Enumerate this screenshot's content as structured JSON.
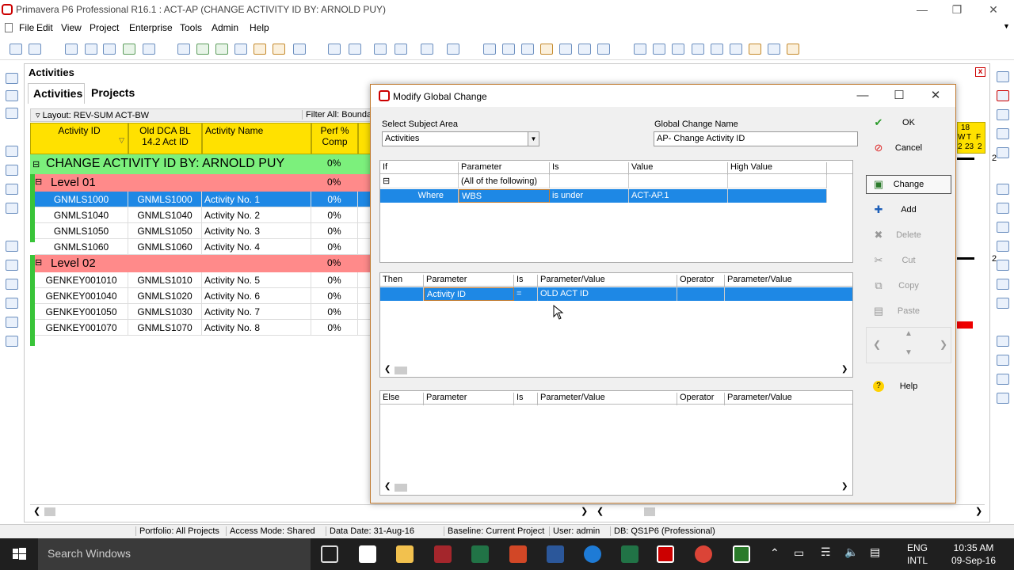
{
  "window": {
    "title": "Primavera P6 Professional R16.1 : ACT-AP (CHANGE ACTIVITY ID BY: ARNOLD PUY)"
  },
  "menu": [
    "File",
    "Edit",
    "View",
    "Project",
    "Enterprise",
    "Tools",
    "Admin",
    "Help"
  ],
  "panel": {
    "title": "Activities",
    "tabs": [
      "Activities",
      "Projects"
    ],
    "layout_label": "Layout: REV-SUM ACT-BW",
    "filter_label": "Filter All: Boundary"
  },
  "grid": {
    "columns": [
      "Activity ID",
      "Old DCA BL 14.2 Act ID",
      "Activity Name",
      "Perf % Comp"
    ],
    "column_lines": {
      "old_dca": [
        "Old DCA BL",
        "14.2 Act ID"
      ],
      "perf": [
        "Perf %",
        "Comp"
      ]
    },
    "project": {
      "name": "CHANGE ACTIVITY ID BY: ARNOLD PUY",
      "perf": "0%"
    },
    "level1": {
      "name": "Level 01",
      "perf": "0%"
    },
    "level2": {
      "name": "Level 02",
      "perf": "0%"
    },
    "rows_level1": [
      {
        "id": "GNMLS1000",
        "old": "GNMLS1000",
        "name": "Activity No. 1",
        "perf": "0%"
      },
      {
        "id": "GNMLS1040",
        "old": "GNMLS1040",
        "name": "Activity No. 2",
        "perf": "0%"
      },
      {
        "id": "GNMLS1050",
        "old": "GNMLS1050",
        "name": "Activity No. 3",
        "perf": "0%"
      },
      {
        "id": "GNMLS1060",
        "old": "GNMLS1060",
        "name": "Activity No. 4",
        "perf": "0%"
      }
    ],
    "rows_level2": [
      {
        "id": "GENKEY001010",
        "old": "GNMLS1010",
        "name": "Activity No. 5",
        "perf": "0%"
      },
      {
        "id": "GENKEY001040",
        "old": "GNMLS1020",
        "name": "Activity No. 6",
        "perf": "0%"
      },
      {
        "id": "GENKEY001050",
        "old": "GNMLS1030",
        "name": "Activity No. 7",
        "perf": "0%"
      },
      {
        "id": "GENKEY001070",
        "old": "GNMLS1070",
        "name": "Activity No. 8",
        "perf": "0%"
      }
    ]
  },
  "gantt": {
    "week": "18",
    "days": [
      "W",
      "T",
      "F"
    ],
    "dates": [
      "2",
      "23",
      "2"
    ],
    "num": "2"
  },
  "dialog": {
    "title": "Modify Global Change",
    "subject_area_label": "Select Subject Area",
    "subject_area_value": "Activities",
    "name_label": "Global Change Name",
    "name_value": "AP- Change Activity ID",
    "if_headers": [
      "If",
      "Parameter",
      "Is",
      "Value",
      "High Value"
    ],
    "if_group": "(All of the following)",
    "if_row": {
      "if": "Where",
      "parameter": "WBS",
      "is": "is under",
      "value": "ACT-AP.1"
    },
    "then_headers": [
      "Then",
      "Parameter",
      "Is",
      "Parameter/Value",
      "Operator",
      "Parameter/Value"
    ],
    "then_row": {
      "parameter": "Activity ID",
      "is": "=",
      "value": "OLD ACT ID"
    },
    "else_headers": [
      "Else",
      "Parameter",
      "Is",
      "Parameter/Value",
      "Operator",
      "Parameter/Value"
    ],
    "buttons": {
      "ok": "OK",
      "cancel": "Cancel",
      "change": "Change",
      "add": "Add",
      "delete": "Delete",
      "cut": "Cut",
      "copy": "Copy",
      "paste": "Paste",
      "help": "Help"
    }
  },
  "status": {
    "portfolio": "Portfolio: All Projects",
    "access": "Access Mode: Shared",
    "data_date": "Data Date: 31-Aug-16",
    "baseline": "Baseline: Current Project",
    "user": "User: admin",
    "db": "DB: QS1P6 (Professional)"
  },
  "taskbar": {
    "search": "Search Windows",
    "lang1": "ENG",
    "lang2": "INTL",
    "time": "10:35 AM",
    "date": "09-Sep-16"
  },
  "colors": {
    "wbs_project": "#7cf07c",
    "wbs_level": "#ff8a8a",
    "header": "#ffe100",
    "selection": "#1e88e5"
  }
}
